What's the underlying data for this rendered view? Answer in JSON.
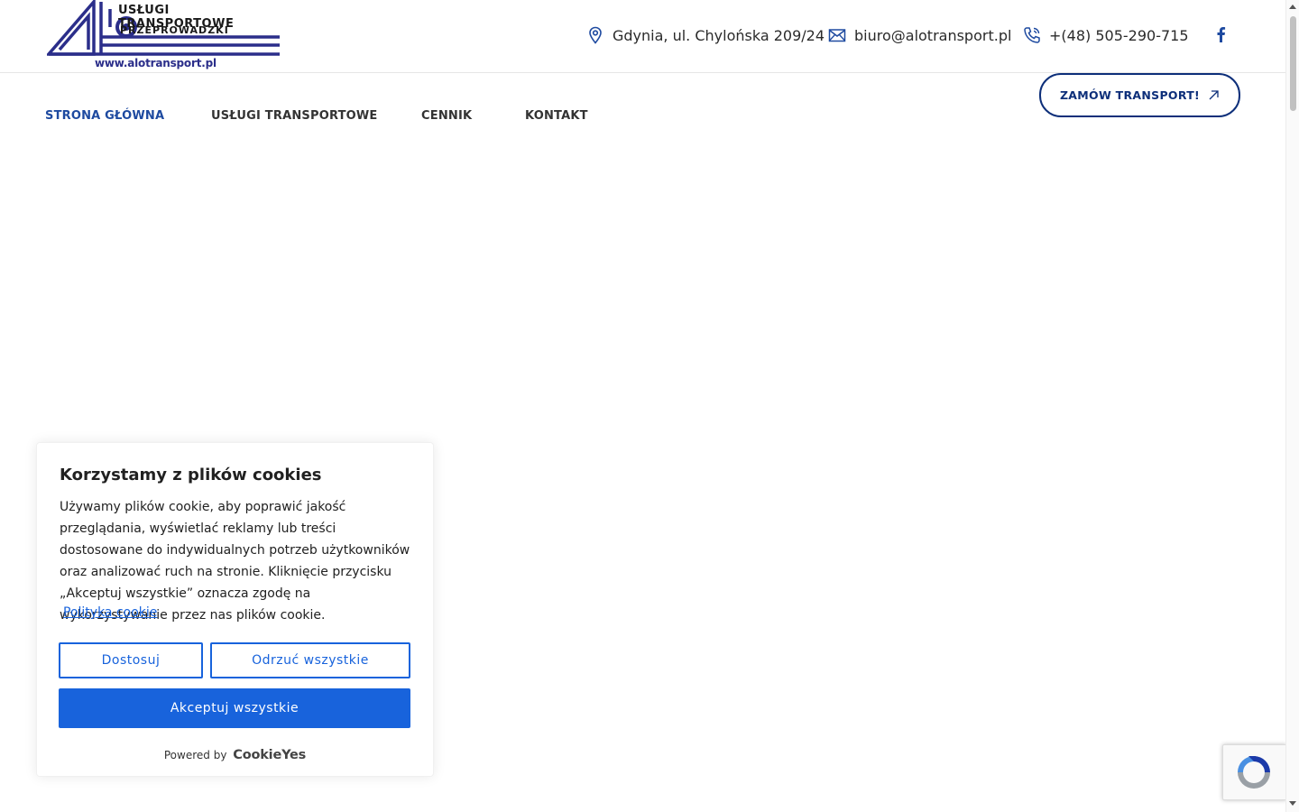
{
  "header": {
    "logo": {
      "line1": "USŁUGI TRANSPORTOWE",
      "line2": "PRZEPROWADZKI",
      "url": "www.alotransport.pl"
    },
    "address": "Gdynia, ul. Chylońska 209/24",
    "email": "biuro@alotransport.pl",
    "phone": "+(48) 505-290-715",
    "social_icon": "facebook-icon"
  },
  "nav": {
    "items": [
      {
        "label": "STRONA GŁÓWNA",
        "active": true
      },
      {
        "label": "USŁUGI TRANSPORTOWE",
        "active": false
      },
      {
        "label": "CENNIK",
        "active": false
      },
      {
        "label": "KONTAKT",
        "active": false
      }
    ],
    "cta_label": "ZAMÓW TRANSPORT!"
  },
  "cookie_banner": {
    "title": "Korzystamy z plików cookies",
    "description": "Używamy plików cookie, aby poprawić jakość przeglądania, wyświetlać reklamy lub treści dostosowane do indywidualnych potrzeb użytkowników oraz analizować ruch na stronie. Kliknięcie przycisku „Akceptuj wszystkie” oznacza zgodę na wykorzystywanie przez nas plików cookie.",
    "policy_link": "Polityka cookie",
    "customize_label": "Dostosuj",
    "reject_label": "Odrzuć wszystkie",
    "accept_label": "Akceptuj wszystkie",
    "powered_by": "Powered by",
    "powered_brand": "CookieYes"
  },
  "colors": {
    "brand_dark_blue": "#0d2f7a",
    "nav_active": "#1e4aa0",
    "cookie_blue": "#1863dc",
    "logo_purple": "#2b2e8a"
  }
}
